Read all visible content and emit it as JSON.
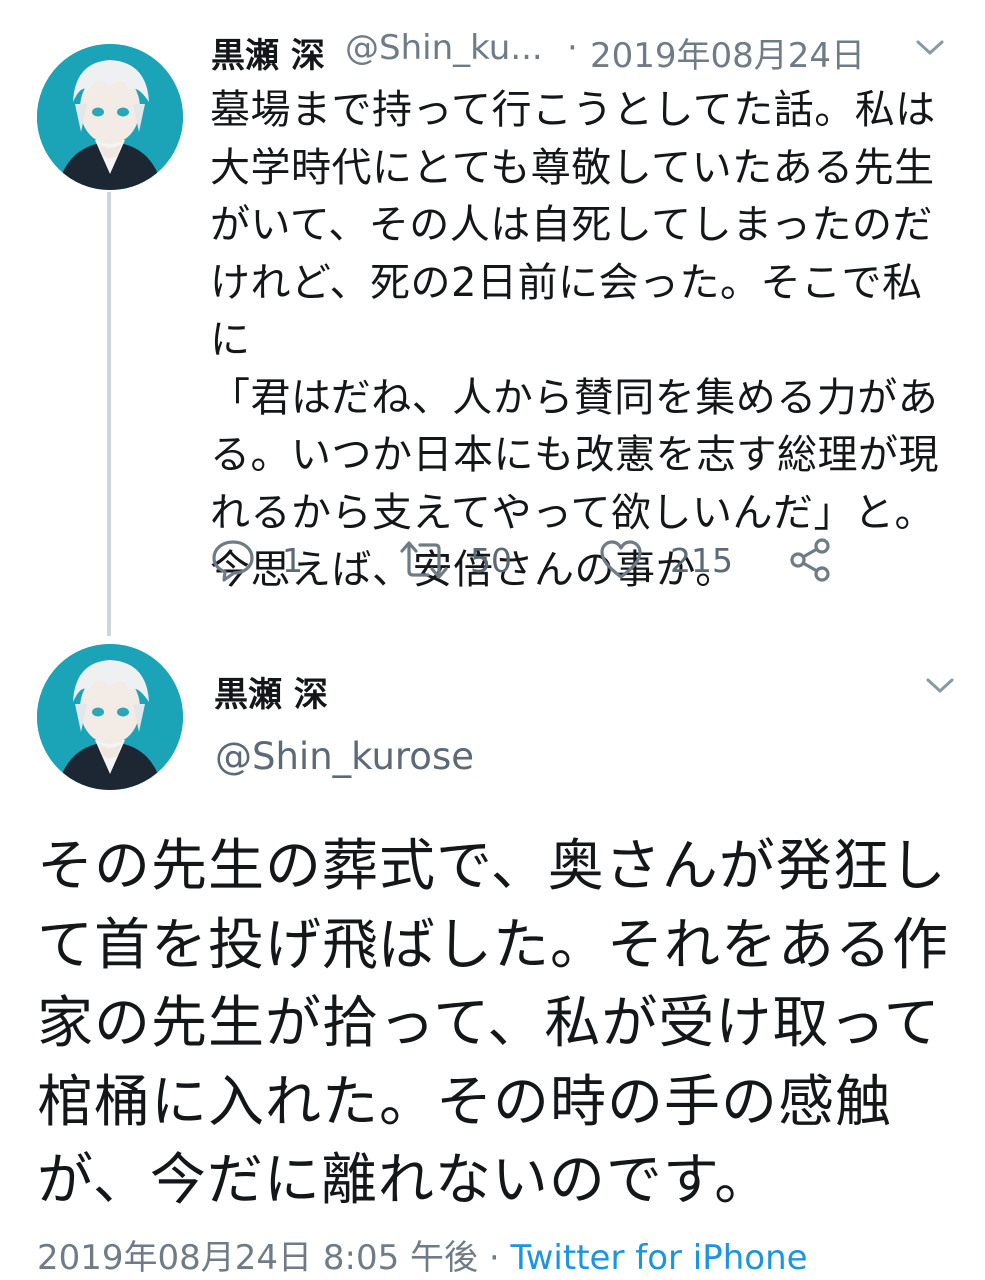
{
  "tweet1": {
    "author_name": "黒瀬 深",
    "handle_truncated": "@Shin_ku...",
    "separator": "·",
    "date": "2019年08月24日",
    "text": "墓場まで持って行こうとしてた話。私は\n大学時代にとても尊敬していたある先生\nがいて、その人は自死してしまったのだ\nけれど、死の2日前に会った。そこで私に\n「君はだね、人から賛同を集める力があ\nる。いつか日本にも改憲を志す総理が現\nれるから支えてやって欲しいんだ」と。\n今思えば、安倍さんの事か。",
    "reply_count": "1",
    "retweet_count": "50",
    "like_count": "215"
  },
  "tweet2": {
    "author_name": "黒瀬 深",
    "handle": "@Shin_kurose",
    "text": "その先生の葬式で、奥さんが発狂し\nて首を投げ飛ばした。それをある作\n家の先生が拾って、私が受け取って\n棺桶に入れた。その時の手の感触\nが、今だに離れないのです。",
    "timestamp": "2019年08月24日 8:05 午後",
    "separator": "·",
    "source": "Twitter for iPhone"
  },
  "icons": {
    "avatar": "anime-avatar-image",
    "reply": "reply-icon",
    "retweet": "retweet-icon",
    "like": "heart-icon",
    "share": "share-icon",
    "menu": "chevron-down-icon"
  },
  "colors": {
    "link": "#1b95e0",
    "secondary_text": "#6f7c87",
    "thread_line": "#cdd6dd",
    "avatar_bg": "#1ba3b8"
  }
}
